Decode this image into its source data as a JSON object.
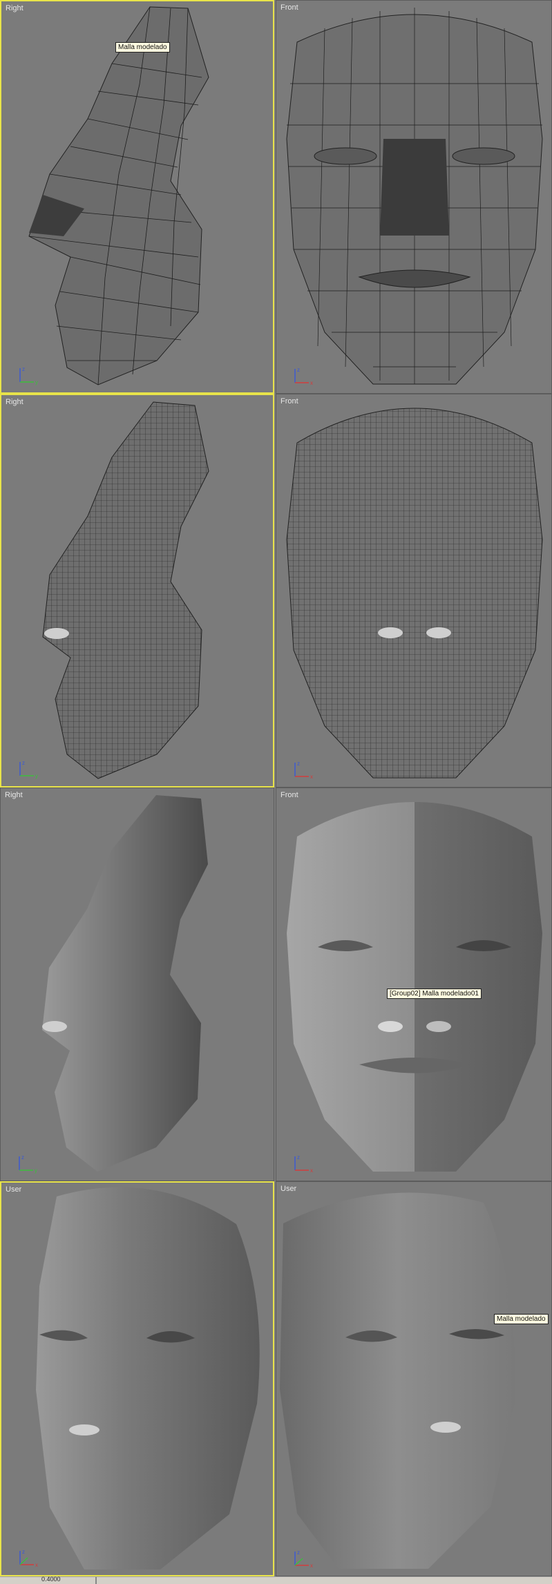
{
  "viewports": [
    {
      "label": "Right"
    },
    {
      "label": "Front"
    },
    {
      "label": "Right"
    },
    {
      "label": "Front"
    },
    {
      "label": "Right"
    },
    {
      "label": "Front"
    },
    {
      "label": "User"
    },
    {
      "label": "User"
    }
  ],
  "tooltips": {
    "vp1": "Malla modelado",
    "vp6": "[Group02] Malla modelado01",
    "vp8": "Malla modelado"
  },
  "axis_labels": {
    "x": "x",
    "y": "y",
    "z": "z"
  },
  "statusbar": {
    "value": "0.4000"
  },
  "icons": {
    "axis": "axis-tripod-icon"
  },
  "colors": {
    "active_border": "#e8e34a",
    "viewport_bg": "#7b7b7b",
    "axis_x": "#d23c3c",
    "axis_y": "#3cbe3c",
    "axis_z": "#3c5ad2"
  }
}
